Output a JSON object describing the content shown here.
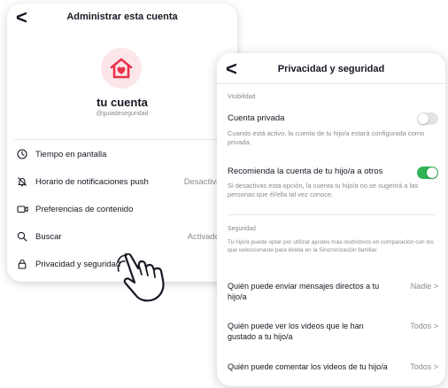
{
  "left": {
    "title": "Administrar esta cuenta",
    "back": "<",
    "username": "tu cuenta",
    "handle": "@guiadeseguridad",
    "items": [
      {
        "label": "Tiempo en pantalla",
        "value": "",
        "icon": "clock-icon"
      },
      {
        "label": "Horario de notificaciones push",
        "value": "Desactivado",
        "icon": "bell-off-icon"
      },
      {
        "label": "Preferencias de contenido",
        "value": "",
        "icon": "video-icon"
      },
      {
        "label": "Buscar",
        "value": "Activado",
        "icon": "search-icon"
      },
      {
        "label": "Privacidad y seguridad",
        "value": "",
        "icon": "lock-icon"
      }
    ]
  },
  "right": {
    "title": "Privacidad y seguridad",
    "back": "<",
    "visibility": {
      "section": "Visibilidad",
      "private_label": "Cuenta privada",
      "private_desc": "Cuando está activo, la cuenta de tu hijo/a estará configurada como privada.",
      "private_on": false,
      "recommend_label": "Recomienda la cuenta de tu hijo/a a otros",
      "recommend_desc": "Si desactivas esta opción, la cuenta tu hijo/a no se sugerirá a las personas que él/ella tal vez conoce.",
      "recommend_on": true
    },
    "security": {
      "section": "Seguridad",
      "desc": "Tu hijo/a puede optar por utilizar ajustes más restrictivos en comparación con los que seleccionaste para él/ella en la Sincronización familiar.",
      "rows": [
        {
          "label": "Quién puede enviar mensajes directos a tu hijo/a",
          "value": "Nadie  >"
        },
        {
          "label": "Quién puede ver los videos que le han gustado a tu hijo/a",
          "value": "Todos  >"
        },
        {
          "label": "Quién puede comentar los videos de tu hijo/a",
          "value": "Todos  >"
        }
      ]
    }
  },
  "colors": {
    "accent_red": "#e8334a",
    "toggle_on": "#2fb354",
    "toggle_off": "#e3e3e6"
  }
}
